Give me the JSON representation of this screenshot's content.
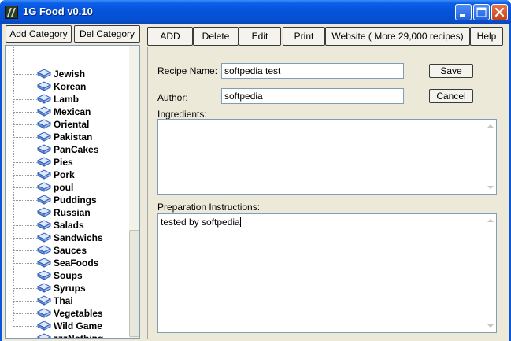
{
  "window": {
    "title": "1G Food v0.10"
  },
  "category_buttons": {
    "add": "Add Category",
    "del": "Del Category"
  },
  "categories": [
    "Jewish",
    "Korean",
    "Lamb",
    "Mexican",
    "Oriental",
    "Pakistan",
    "PanCakes",
    "Pies",
    "Pork",
    "poul",
    "Puddings",
    "Russian",
    "Salads",
    "Sandwichs",
    "Sauces",
    "SeaFoods",
    "Soups",
    "Syrups",
    "Thai",
    "Vegetables",
    "Wild Game",
    "zzzNothing"
  ],
  "toolbar": {
    "add": "ADD",
    "delete": "Delete",
    "edit": "Edit",
    "print": "Print",
    "website": "Website ( More 29,000 recipes)",
    "help": "Help"
  },
  "form": {
    "recipe_name_label": "Recipe Name:",
    "recipe_name_value": "softpedia test",
    "author_label": "Author:",
    "author_value": "softpedia",
    "save": "Save",
    "cancel": "Cancel",
    "ingredients_label": "Ingredients:",
    "ingredients_value": "",
    "preparation_label": "Preparation Instructions:",
    "preparation_value": "tested by softpedia"
  },
  "icons": {
    "app": "app-icon",
    "minimize": "minimize-icon",
    "maximize": "maximize-icon",
    "close": "close-icon",
    "category": "book-icon"
  }
}
